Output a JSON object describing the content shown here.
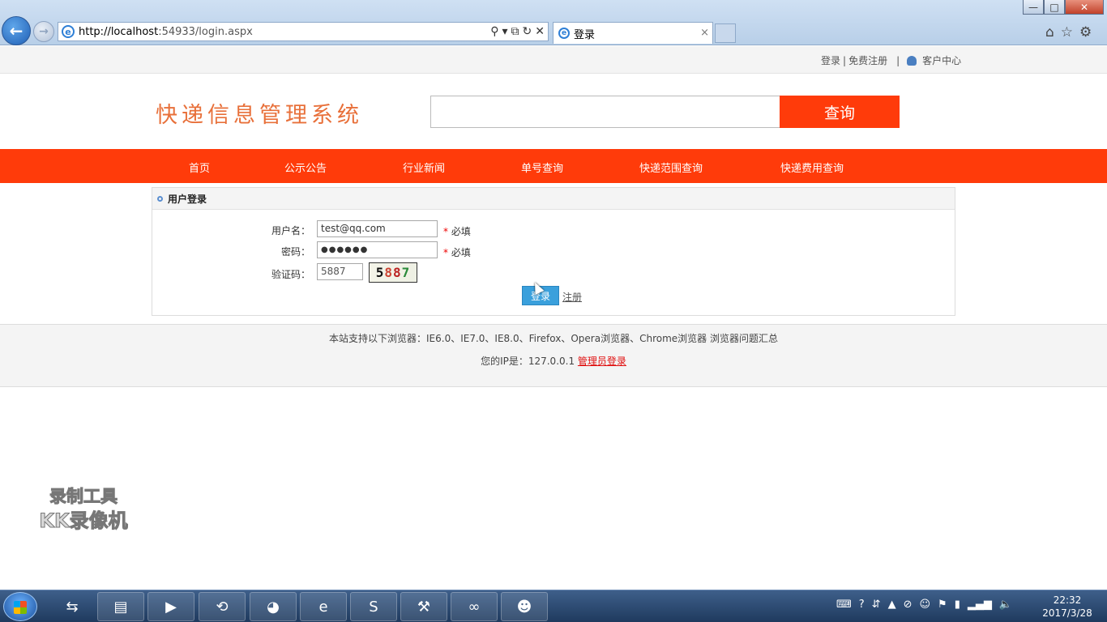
{
  "browser": {
    "url_host": "http://localhost",
    "url_rest": ":54933/login.aspx",
    "tab_title": "登录",
    "tab_close": "×",
    "back_glyph": "←",
    "forward_glyph": "→",
    "addr_icons": [
      "search-icon",
      "dropdown-icon",
      "compat-icon",
      "refresh-icon",
      "stop-icon"
    ],
    "addr_icon_glyphs": [
      "⚲",
      "▾",
      "⧉",
      "↻",
      "✕"
    ],
    "win_min": "—",
    "win_max": "□",
    "win_close": "✕",
    "toolbar_glyphs": [
      "⌂",
      "☆",
      "⚙"
    ]
  },
  "topbar": {
    "login": "登录",
    "sep1": "|",
    "register": "免费注册",
    "sep2": "|",
    "customer_center": "客户中心"
  },
  "header": {
    "logo": "快递信息管理系统",
    "search_placeholder": "",
    "search_button": "查询"
  },
  "nav": {
    "items": [
      "首页",
      "公示公告",
      "行业新闻",
      "单号查询",
      "快递范围查询",
      "快递费用查询"
    ]
  },
  "login_panel": {
    "title": "用户登录",
    "username_label": "用户名：",
    "username_value": "test@qq.com",
    "password_label": "密码：",
    "password_value": "●●●●●●",
    "captcha_label": "验证码：",
    "captcha_value": "5887",
    "captcha_image_chars": [
      "5",
      "8",
      "8",
      "7"
    ],
    "required_star": "*",
    "required_text": "必填",
    "login_button": "登录",
    "register_link": "注册"
  },
  "footer": {
    "browsers_text": "本站支持以下浏览器：IE6.0、IE7.0、IE8.0、Firefox、Opera浏览器、Chrome浏览器 浏览器问题汇总",
    "ip_text": "您的IP是：127.0.0.1 ",
    "admin_login": "管理员登录"
  },
  "watermark": {
    "line1": "录制工具",
    "line2": "KK录像机"
  },
  "taskbar": {
    "apps": [
      "teamviewer-icon",
      "explorer-icon",
      "media-player-icon",
      "sync-icon",
      "qq-icon",
      "ie-icon",
      "wps-icon",
      "tools-icon",
      "visual-studio-icon",
      "game-icon"
    ],
    "app_glyphs": [
      "⇆",
      "▤",
      "▶",
      "⟲",
      "◕",
      "e",
      "S",
      "⚒",
      "∞",
      "☻"
    ],
    "tray_glyphs": [
      "⌨",
      "?",
      "⇵",
      "▲",
      "⊘",
      "☺",
      "⚑",
      "▮",
      "▂▄▆",
      "🔈"
    ],
    "time": "22:32",
    "date": "2017/3/28"
  }
}
